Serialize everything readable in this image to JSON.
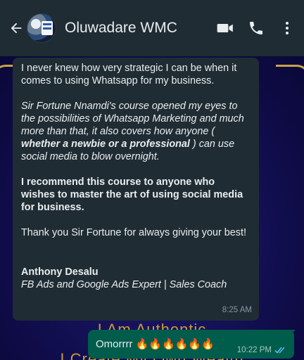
{
  "header": {
    "contact_name": "Oluwadare WMC",
    "icons": [
      "back-arrow-icon",
      "video-call-icon",
      "voice-call-icon",
      "more-vertical-icon"
    ]
  },
  "wallpaper": {
    "line1": "I Am Authentic",
    "line2": "I Create My Own Wealth"
  },
  "incoming_message": {
    "p1": "I never knew how very strategic I can be when it comes to using Whatsapp for my business.",
    "p2_before": "Sir Fortune Nnamdi's course opened my eyes to the possibilities of Whatsapp Marketing and much more than that, it also covers how anyone ( ",
    "p2_bold": "whether a newbie or a professional",
    "p2_after": " ) can use social media to blow overnight.",
    "p3": "I recommend this course to anyone who wishes to master the art of using social media for business.",
    "p4": "Thank you Sir Fortune for always giving your best!",
    "signature_name": "Anthony Desalu",
    "signature_title": "FB Ads and Google Ads Expert | Sales Coach",
    "time": "8:25 AM"
  },
  "outgoing_message": {
    "text": "Omorrrr 🔥🔥🔥🔥🔥🔥",
    "time": "10:22 PM",
    "status": "read"
  },
  "colors": {
    "app_bar": "#1f2c34",
    "incoming_bubble": "#202c33",
    "outgoing_bubble": "#005c4b",
    "read_tick": "#53bdeb"
  }
}
